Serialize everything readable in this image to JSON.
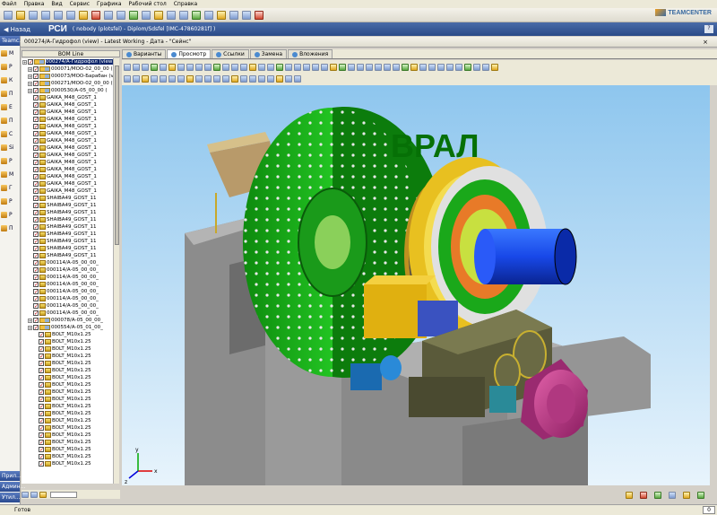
{
  "menu": [
    "Файл",
    "Правка",
    "Вид",
    "Сервис",
    "Графика",
    "Рабочий стол",
    "Справка"
  ],
  "logo_text": "TEAMCENTER",
  "appbar": {
    "back_label": "Назад",
    "context": "РСИ",
    "info": "( nobody (plotsfel) - Diplom/Sdsfel   [IMC-47860281f] )",
    "help": "?"
  },
  "left_panel": {
    "top": "Teamc...",
    "items": [
      {
        "label": "М",
        "icon": "folder-icon"
      },
      {
        "label": "P",
        "icon": "folder-icon"
      },
      {
        "label": "К",
        "icon": "folder-icon"
      },
      {
        "label": "П",
        "icon": "document-icon"
      },
      {
        "label": "Е",
        "icon": "folder-icon"
      },
      {
        "label": "П",
        "icon": "document-icon"
      },
      {
        "label": "С",
        "icon": "folder-icon"
      },
      {
        "label": "Si",
        "icon": "folder-icon"
      },
      {
        "label": "Р",
        "icon": "folder-icon"
      },
      {
        "label": "М",
        "icon": "folder-icon"
      },
      {
        "label": "Г",
        "icon": "folder-icon"
      },
      {
        "label": "Р",
        "icon": "folder-icon"
      },
      {
        "label": "Р",
        "icon": "folder-icon"
      },
      {
        "label": "П",
        "icon": "folder-icon"
      }
    ],
    "bottom_buttons": [
      "Прил...",
      "Админ...",
      "Утил..."
    ]
  },
  "tabbar": {
    "title": "000274/А-Гидрофол (view) - Latest Working - Дата - \"Сейнс\""
  },
  "tree": {
    "header": "BOM Line",
    "rows": [
      {
        "label": "000274/А-Гидрофол (view)",
        "indent": 0,
        "type": "root",
        "selected": true
      },
      {
        "label": "000071/МОО-02_00_00 (",
        "indent": 1,
        "type": "asm"
      },
      {
        "label": "000073/МОО-Барабан (v",
        "indent": 1,
        "type": "asm"
      },
      {
        "label": "000271/МОО-02_00_00 (",
        "indent": 1,
        "type": "asm"
      },
      {
        "label": "0000530/А-05_00_00 (",
        "indent": 1,
        "type": "asm"
      },
      {
        "label": "GAIKA_M48_GOST_1",
        "indent": 2,
        "type": "part"
      },
      {
        "label": "GAIKA_M48_GOST_1",
        "indent": 2,
        "type": "part"
      },
      {
        "label": "GAIKA_M48_GOST_1",
        "indent": 2,
        "type": "part"
      },
      {
        "label": "GAIKA_M48_GOST_1",
        "indent": 2,
        "type": "part"
      },
      {
        "label": "GAIKA_M48_GOST_1",
        "indent": 2,
        "type": "part"
      },
      {
        "label": "GAIKA_M48_GOST_1",
        "indent": 2,
        "type": "part"
      },
      {
        "label": "GAIKA_M48_GOST_1",
        "indent": 2,
        "type": "part"
      },
      {
        "label": "GAIKA_M48_GOST_1",
        "indent": 2,
        "type": "part"
      },
      {
        "label": "GAIKA_M48_GOST_1",
        "indent": 2,
        "type": "part"
      },
      {
        "label": "GAIKA_M48_GOST_1",
        "indent": 2,
        "type": "part"
      },
      {
        "label": "GAIKA_M48_GOST_1",
        "indent": 2,
        "type": "part"
      },
      {
        "label": "GAIKA_M48_GOST_1",
        "indent": 2,
        "type": "part"
      },
      {
        "label": "GAIKA_M48_GOST_1",
        "indent": 2,
        "type": "part"
      },
      {
        "label": "GAIKA_M48_GOST_1",
        "indent": 2,
        "type": "part"
      },
      {
        "label": "SHAIBA49_GOST_11",
        "indent": 2,
        "type": "part"
      },
      {
        "label": "SHAIBA49_GOST_11",
        "indent": 2,
        "type": "part"
      },
      {
        "label": "SHAIBA49_GOST_11",
        "indent": 2,
        "type": "part"
      },
      {
        "label": "SHAIBA49_GOST_11",
        "indent": 2,
        "type": "part"
      },
      {
        "label": "SHAIBA49_GOST_11",
        "indent": 2,
        "type": "part"
      },
      {
        "label": "SHAIBA49_GOST_11",
        "indent": 2,
        "type": "part"
      },
      {
        "label": "SHAIBA49_GOST_11",
        "indent": 2,
        "type": "part"
      },
      {
        "label": "SHAIBA49_GOST_11",
        "indent": 2,
        "type": "part"
      },
      {
        "label": "SHAIBA49_GOST_11",
        "indent": 2,
        "type": "part"
      },
      {
        "label": "000114/А-05_00_00_",
        "indent": 2,
        "type": "part"
      },
      {
        "label": "000114/А-05_00_00_",
        "indent": 2,
        "type": "part"
      },
      {
        "label": "000114/А-05_00_00_",
        "indent": 2,
        "type": "part"
      },
      {
        "label": "000114/А-05_00_00_",
        "indent": 2,
        "type": "part"
      },
      {
        "label": "000114/А-05_00_00_",
        "indent": 2,
        "type": "part"
      },
      {
        "label": "000114/А-05_00_00_",
        "indent": 2,
        "type": "part"
      },
      {
        "label": "000114/А-05_00_00_",
        "indent": 2,
        "type": "part"
      },
      {
        "label": "000114/А-05_00_00_",
        "indent": 2,
        "type": "part"
      },
      {
        "label": "000078/А-05_00_00_",
        "indent": 1,
        "type": "asm"
      },
      {
        "label": "000554/А-05_01_00_",
        "indent": 1,
        "type": "asm"
      },
      {
        "label": "BOLT_M10x1.25",
        "indent": 3,
        "type": "part"
      },
      {
        "label": "BOLT_M10x1.25",
        "indent": 3,
        "type": "part"
      },
      {
        "label": "BOLT_M10x1.25",
        "indent": 3,
        "type": "part"
      },
      {
        "label": "BOLT_M10x1.25",
        "indent": 3,
        "type": "part"
      },
      {
        "label": "BOLT_M10x1.25",
        "indent": 3,
        "type": "part"
      },
      {
        "label": "BOLT_M10x1.25",
        "indent": 3,
        "type": "part"
      },
      {
        "label": "BOLT_M10x1.25",
        "indent": 3,
        "type": "part"
      },
      {
        "label": "BOLT_M10x1.25",
        "indent": 3,
        "type": "part"
      },
      {
        "label": "BOLT_M10x1.25",
        "indent": 3,
        "type": "part"
      },
      {
        "label": "BOLT_M10x1.25",
        "indent": 3,
        "type": "part"
      },
      {
        "label": "BOLT_M10x1.25",
        "indent": 3,
        "type": "part"
      },
      {
        "label": "BOLT_M10x1.25",
        "indent": 3,
        "type": "part"
      },
      {
        "label": "BOLT_M10x1.25",
        "indent": 3,
        "type": "part"
      },
      {
        "label": "BOLT_M10x1.25",
        "indent": 3,
        "type": "part"
      },
      {
        "label": "BOLT_M10x1.25",
        "indent": 3,
        "type": "part"
      },
      {
        "label": "BOLT_M10x1.25",
        "indent": 3,
        "type": "part"
      },
      {
        "label": "BOLT_M10x1.25",
        "indent": 3,
        "type": "part"
      },
      {
        "label": "BOLT_M10x1.25",
        "indent": 3,
        "type": "part"
      },
      {
        "label": "BOLT_M10x1.25",
        "indent": 3,
        "type": "part"
      }
    ]
  },
  "viewer_tabs": [
    {
      "label": "Варианты",
      "active": false
    },
    {
      "label": "Просмотр",
      "active": true
    },
    {
      "label": "Ссылки",
      "active": false
    },
    {
      "label": "Замена",
      "active": false
    },
    {
      "label": "Вложения",
      "active": false
    }
  ],
  "viewer": {
    "model_colors": {
      "drum": "#1aa81a",
      "flange": "#e8c020",
      "shaft": "#1848e8",
      "motor": "#c03888",
      "gearbox": "#5a5a40",
      "foundation": "#8a8a8a",
      "background_top": "#8ec6ee",
      "background_bottom": "#e8f4fc"
    },
    "drum_text": "ВРАЛ",
    "axis_labels": [
      "x",
      "y",
      "z"
    ]
  },
  "status": {
    "text": "Готов",
    "page": "0"
  }
}
